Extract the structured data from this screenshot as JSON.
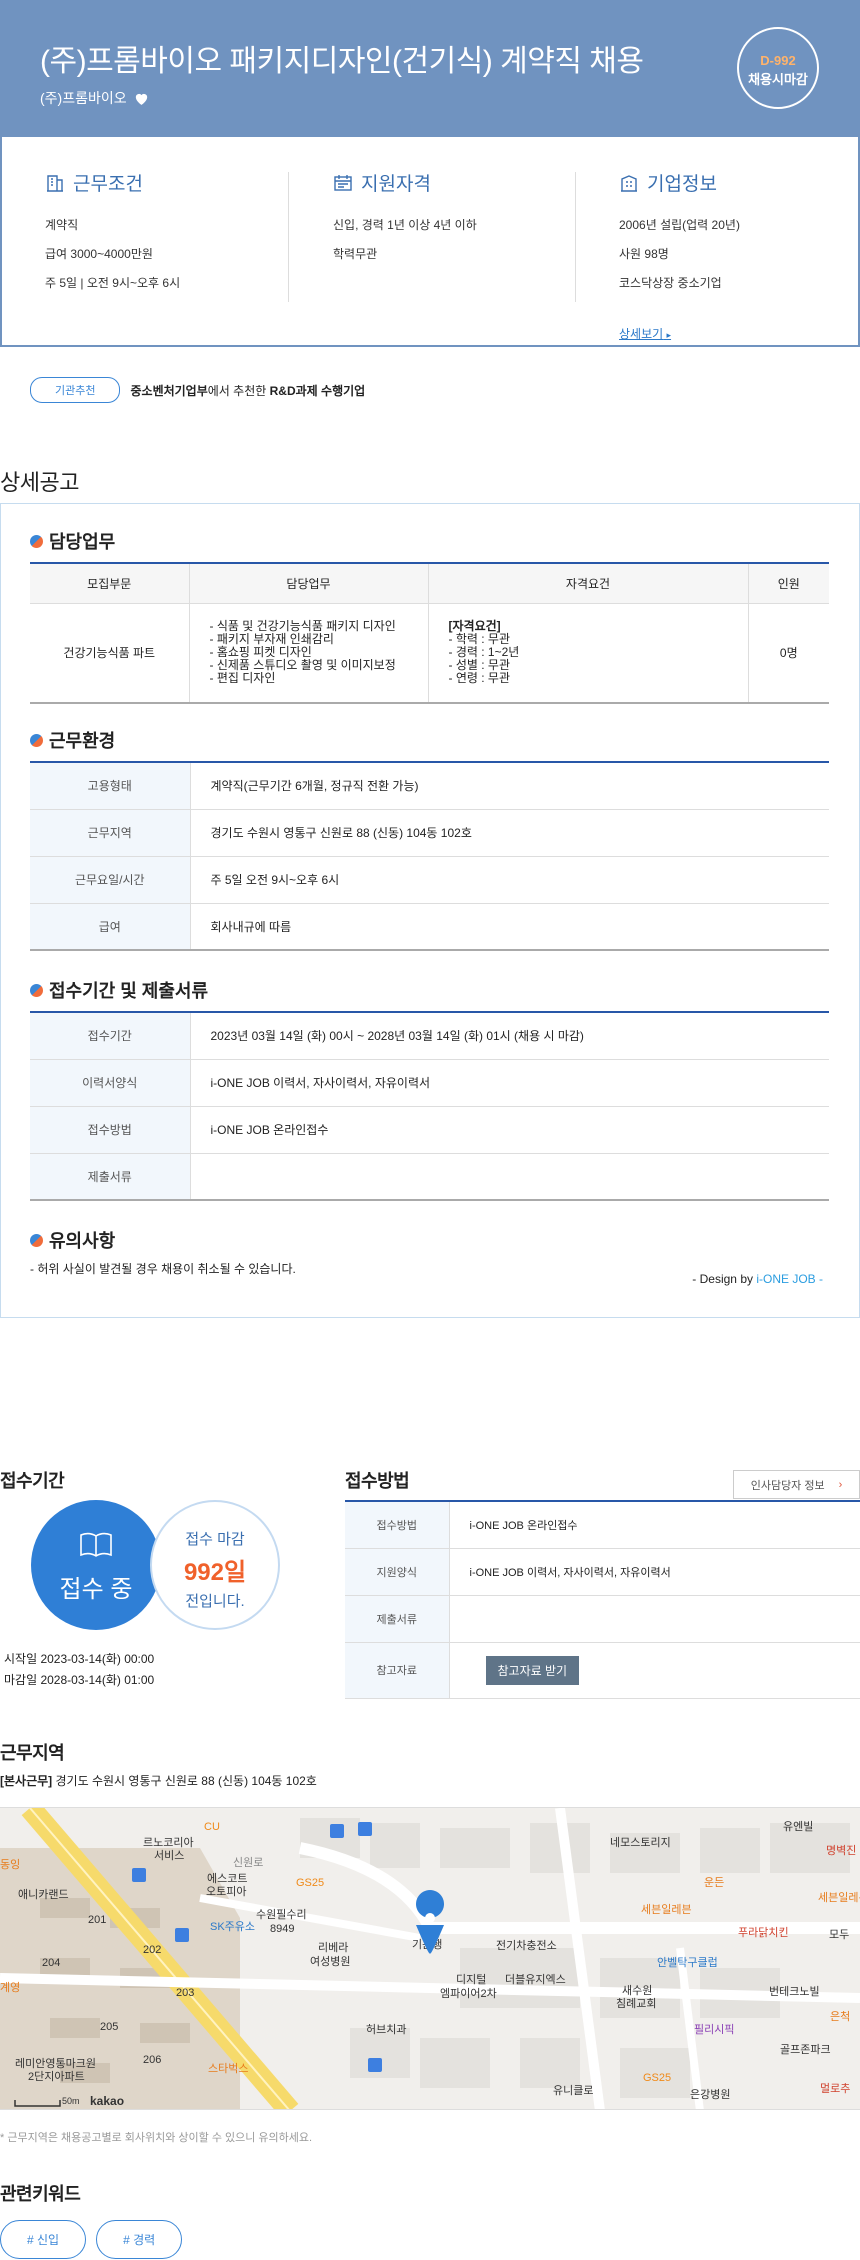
{
  "header": {
    "title": "(주)프롬바이오 패키지디자인(건기식) 계약직 채용",
    "company": "(주)프롬바이오",
    "dday": "D-992",
    "dday_caption": "채용시마감"
  },
  "summary": {
    "work": {
      "title": "근무조건",
      "lines": [
        "계약직",
        "급여 3000~4000만원",
        "주 5일 | 오전 9시~오후 6시"
      ]
    },
    "qual": {
      "title": "지원자격",
      "lines": [
        "신입, 경력 1년 이상 4년 이하",
        "학력무관"
      ]
    },
    "company": {
      "title": "기업정보",
      "lines": [
        "2006년 설립(업력 20년)",
        "사원 98명",
        "코스닥상장 중소기업"
      ],
      "more": "상세보기"
    }
  },
  "recommend": {
    "badge": "기관추천",
    "org": "중소벤처기업부",
    "mid": "에서 추천한 ",
    "kind": "R&D과제 수행기업"
  },
  "detail": {
    "heading": "상세공고",
    "duty": {
      "title": "담당업무",
      "headers": [
        "모집부문",
        "담당업무",
        "자격요건",
        "인원"
      ],
      "row": {
        "dept": "건강기능식품 파트",
        "tasks": [
          "- 식품 및 건강기능식품 패키지 디자인",
          "- 패키지 부자재 인쇄감리",
          "- 홈쇼핑 피켓 디자인",
          "- 신제품 스튜디오 촬영 및 이미지보정",
          "- 편집 디자인"
        ],
        "req_title": "[자격요건]",
        "reqs": [
          "- 학력 : 무관",
          "- 경력 : 1~2년",
          "- 성별 : 무관",
          "- 연령 : 무관"
        ],
        "count": "0명"
      }
    },
    "env": {
      "title": "근무환경",
      "rows": [
        {
          "k": "고용형태",
          "v": "계약직(근무기간 6개월, 정규직 전환 가능)"
        },
        {
          "k": "근무지역",
          "v": "경기도 수원시 영통구 신원로 88 (신동) 104동 102호"
        },
        {
          "k": "근무요일/시간",
          "v": "주 5일 오전 9시~오후 6시"
        },
        {
          "k": "급여",
          "v": "회사내규에 따름"
        }
      ]
    },
    "apply": {
      "title": "접수기간 및 제출서류",
      "rows": [
        {
          "k": "접수기간",
          "v": "2023년 03월 14일 (화) 00시 ~ 2028년 03월 14일 (화) 01시 (채용 시 마감)"
        },
        {
          "k": "이력서양식",
          "v": "i-ONE JOB 이력서, 자사이력서, 자유이력서"
        },
        {
          "k": "접수방법",
          "v": "i-ONE JOB 온라인접수"
        },
        {
          "k": "제출서류",
          "v": ""
        }
      ]
    },
    "caution": {
      "title": "유의사항",
      "text": "- 허위 사실이 발견될 경우 채용이 취소될 수 있습니다."
    },
    "design_prefix": "- Design by ",
    "design_brand": "i-ONE JOB -"
  },
  "period": {
    "heading": "접수기간",
    "status": "접수 중",
    "small1": "접수 마감",
    "small2": "992일",
    "small3": "전입니다.",
    "start": "시작일 2023-03-14(화) 00:00",
    "end": "마감일 2028-03-14(화) 01:00"
  },
  "method": {
    "heading": "접수방법",
    "hr_button": "인사담당자 정보",
    "rows": [
      {
        "k": "접수방법",
        "v": "i-ONE JOB 온라인접수"
      },
      {
        "k": "지원양식",
        "v": "i-ONE JOB 이력서, 자사이력서, 자유이력서"
      },
      {
        "k": "제출서류",
        "v": ""
      }
    ],
    "ref_label": "참고자료",
    "ref_button": "참고자료 받기"
  },
  "location": {
    "heading": "근무지역",
    "tag": "[본사근무]",
    "address": " 경기도 수원시 영통구 신원로 88 (신동) 104동 102호",
    "note": "* 근무지역은 채용공고별로 회사위치와 상이할 수 있으니 유의하세요.",
    "map_labels": {
      "cu": "CU",
      "renoko": "르노코리아",
      "service": "서비스",
      "escort": "에스코트",
      "autopia": "오토피아",
      "g525a": "GS25",
      "skoil": "SK주유소",
      "suwon_clinic": "수원필수리",
      "num8949": "8949",
      "annycand": "애니카랜드",
      "n201": "201",
      "n202": "202",
      "n203": "203",
      "n204": "204",
      "n205": "205",
      "n206": "206",
      "rivera": "리베라",
      "hospital": "여성병원",
      "digital": "디지털",
      "empire": "엠파이어2차",
      "ele": "전기차충전소",
      "better": "더블유지엑스",
      "herb": "허브치과",
      "starbucks": "스타벅스",
      "remian": "레미안영통마크원",
      "danji": "2단지아파트",
      "neimos": "네모스토리지",
      "unben": "유엔빌",
      "myungbeok": "명벽진",
      "seben": "세븐일레븐",
      "seben2": "세븐일레븐",
      "puradak": "푸라닭치킨",
      "modu": "모두",
      "anbel": "안벨탁구클럽",
      "newchurch": "새수원",
      "church": "침례교회",
      "bentech": "번테크노빌",
      "pillace": "필리시픽",
      "golf": "골프존파크",
      "g525b": "GS25",
      "yuni": "유니클로",
      "onhang": "은강병원",
      "meoks": "멀로추",
      "yundeung": "운든",
      "dong": "동잉",
      "gun": "기운행",
      "gyeyang": "계영",
      "sinwon": "신원로",
      "scale": "50m",
      "brand": "kakao",
      "eunjuk": "은척"
    }
  },
  "keywords": {
    "heading": "관련키워드",
    "items": [
      "# 신입",
      "# 경력"
    ]
  }
}
